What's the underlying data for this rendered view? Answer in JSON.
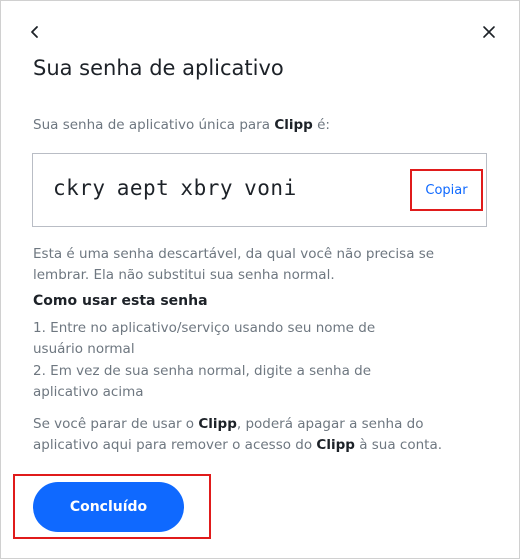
{
  "dialog": {
    "title": "Sua senha de aplicativo",
    "intro_prefix": "Sua senha de aplicativo única para ",
    "app_name": "Clipp",
    "intro_suffix": " é:",
    "password": "ckry aept xbry voni",
    "copy_label": "Copiar",
    "disclaimer": "Esta é uma senha descartável, da qual você não precisa se lembrar. Ela não substitui sua senha normal.",
    "howto_title": "Como usar esta senha",
    "step1": "1. Entre no aplicativo/serviço usando seu nome de usuário normal",
    "step2": "2. Em vez de sua senha normal, digite a senha de aplicativo acima",
    "revoke_1": "Se você parar de usar o ",
    "revoke_app1": "Clipp",
    "revoke_2": ", poderá apagar a senha do aplicativo aqui para remover o acesso do ",
    "revoke_app2": "Clipp",
    "revoke_3": " à sua conta.",
    "done_label": "Concluído"
  },
  "icons": {
    "back": "chevron-left-icon",
    "close": "close-icon"
  },
  "colors": {
    "primary": "#0f69ff",
    "highlight": "#e01b1b",
    "muted_text": "#6e7780",
    "text": "#1d2228"
  }
}
